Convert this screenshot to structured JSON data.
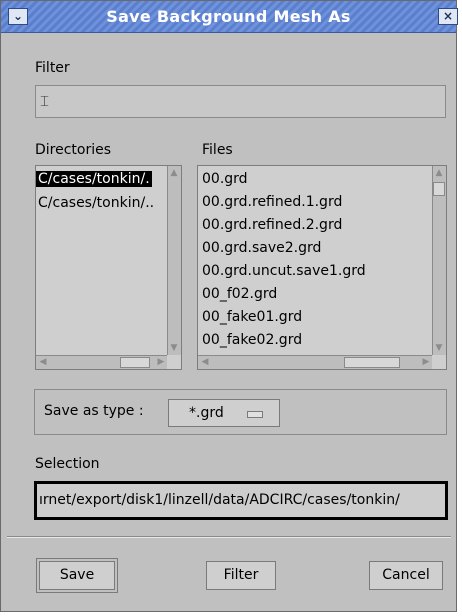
{
  "window": {
    "title": "Save Background Mesh As"
  },
  "titlebar": {
    "menu_icon": "chevron-down-icon",
    "close_icon": "close-icon",
    "menu_glyph": "⌄",
    "close_glyph": "×"
  },
  "filter": {
    "label": "Filter",
    "value": ""
  },
  "directories": {
    "label": "Directories",
    "items": [
      {
        "text": "C/cases/tonkin/.",
        "selected": true
      },
      {
        "text": "C/cases/tonkin/..",
        "selected": false
      }
    ]
  },
  "files": {
    "label": "Files",
    "items": [
      "00.grd",
      "00.grd.refined.1.grd",
      "00.grd.refined.2.grd",
      "00.grd.save2.grd",
      "00.grd.uncut.save1.grd",
      "00_f02.grd",
      "00_fake01.grd",
      "00_fake02.grd"
    ]
  },
  "save_type": {
    "label": "Save as type :",
    "value": "*.grd"
  },
  "selection": {
    "label": "Selection",
    "value": "ırnet/export/disk1/linzell/data/ADCIRC/cases/tonkin/"
  },
  "buttons": {
    "save": "Save",
    "filter": "Filter",
    "cancel": "Cancel"
  },
  "colors": {
    "title_bg": "#5b7fcc",
    "dialog_bg": "#c0c0c0",
    "selection_bg": "#000000"
  }
}
